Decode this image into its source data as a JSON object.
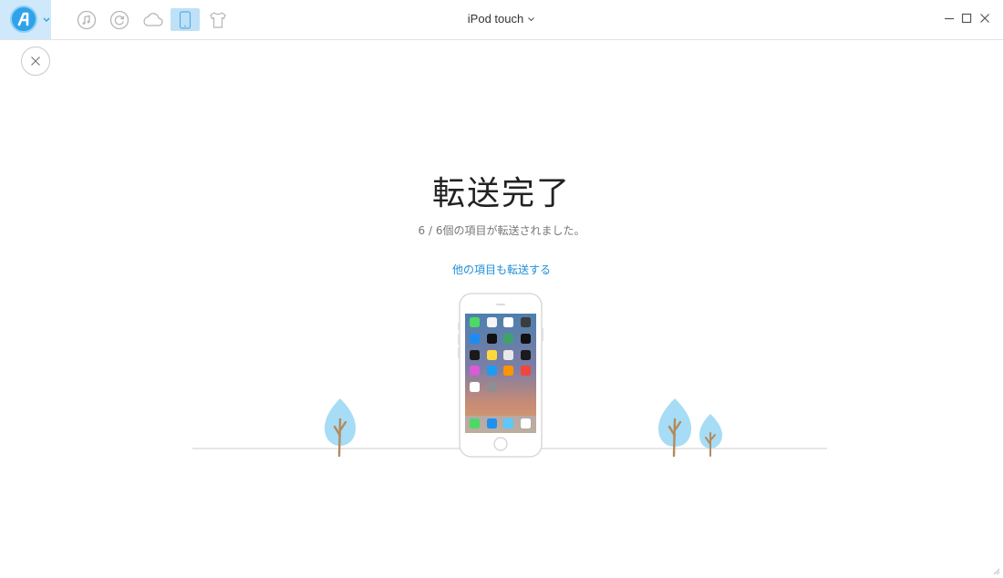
{
  "app": {
    "device_name": "iPod touch"
  },
  "toolbar": {
    "tools": [
      {
        "name": "music-icon",
        "active": false
      },
      {
        "name": "restore-icon",
        "active": false
      },
      {
        "name": "cloud-icon",
        "active": false
      },
      {
        "name": "phone-icon",
        "active": true
      },
      {
        "name": "tshirt-icon",
        "active": false
      }
    ]
  },
  "main": {
    "title": "転送完了",
    "summary": "6 / 6個の項目が転送されました。",
    "link_label": "他の項目も転送する"
  },
  "colors": {
    "accent": "#1e8fd6",
    "logo": "#2ea3ea",
    "active_tool_bg": "#bfe1f8",
    "tree": "#a6dcf5"
  }
}
